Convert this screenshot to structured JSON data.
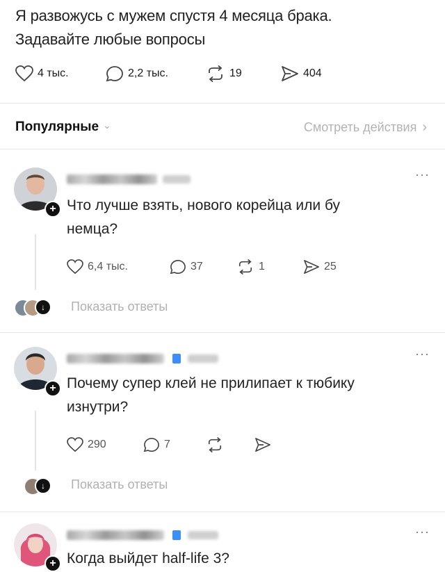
{
  "post": {
    "text_line1": "Я развожусь с мужем спустя 4 месяца брака.",
    "text_line2": "Задавайте любые вопросы",
    "likes": "4 тыс.",
    "comments": "2,2 тыс.",
    "reposts": "19",
    "shares": "404"
  },
  "filter": {
    "label": "Популярные",
    "view_actions": "Смотреть действия"
  },
  "comments": [
    {
      "text_line1": "Что лучше взять, нового корейца или бу",
      "text_line2": "немца?",
      "likes": "6,4 тыс.",
      "replies": "37",
      "reposts": "1",
      "shares": "25",
      "show_replies": "Показать ответы",
      "more": "···"
    },
    {
      "text_line1": "Почему супер клей не прилипает к тюбику",
      "text_line2": "изнутри?",
      "likes": "290",
      "replies": "7",
      "reposts": "",
      "shares": "",
      "show_replies": "Показать ответы",
      "more": "···"
    },
    {
      "text_line1": "Когда выйдет half-life 3?",
      "more": "···"
    }
  ],
  "colors": {
    "verified": "#3e8ef7",
    "muted": "#b0b0b0",
    "text": "#222222"
  },
  "icons": {
    "plus": "+",
    "chevron_down": "⌄",
    "chevron_right": "›",
    "arrow_down": "↓"
  }
}
